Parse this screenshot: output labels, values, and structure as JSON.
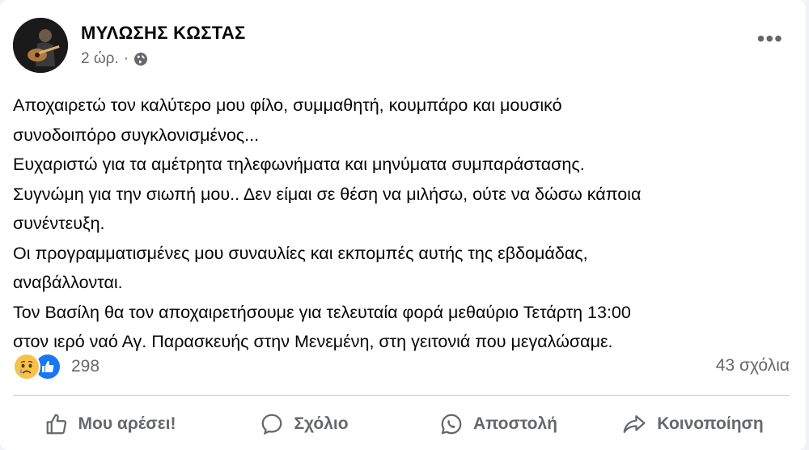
{
  "post": {
    "author": "ΜΥΛΩΣΗΣ ΚΩΣΤΑΣ",
    "time": "2 ώρ.",
    "separator": "·",
    "privacy_icon": "globe-icon",
    "more_icon": "more-options-icon",
    "lines": [
      "Αποχαιρετώ τον καλύτερο μου φίλο, συμμαθητή, κουμπάρο και  μουσικό",
      "συνοδοιπόρο συγκλονισμένος...",
      "Ευχαριστώ για τα αμέτρητα τηλεφωνήματα και μηνύματα συμπαράστασης.",
      "Συγνώμη για την σιωπή μου.. Δεν είμαι σε θέση να μιλήσω, ούτε να δώσω κάποια",
      "συνέντευξη.",
      "Οι προγραμματισμένες μου συναυλίες και εκπομπές αυτής της εβδομάδας,",
      "αναβάλλονται.",
      "Τον Βασίλη θα τον αποχαιρετήσουμε για τελευταία φορά μεθαύριο Τετάρτη 13:00",
      "στον ιερό ναό Αγ. Παρασκευής στην Μενεμένη, στη γειτονιά που μεγαλώσαμε."
    ]
  },
  "reactions": {
    "icons": [
      "sad-reaction-icon",
      "like-reaction-icon"
    ],
    "count": "298",
    "comments": "43 σχόλια"
  },
  "actions": {
    "like": "Μου αρέσει!",
    "comment": "Σχόλιο",
    "send": "Αποστολή",
    "share": "Κοινοποίηση"
  },
  "colors": {
    "text": "#050505",
    "secondary": "#65676b",
    "like_blue": "#1877f2",
    "sad_yellow": "#f7c24a",
    "divider": "#ced0d4"
  }
}
